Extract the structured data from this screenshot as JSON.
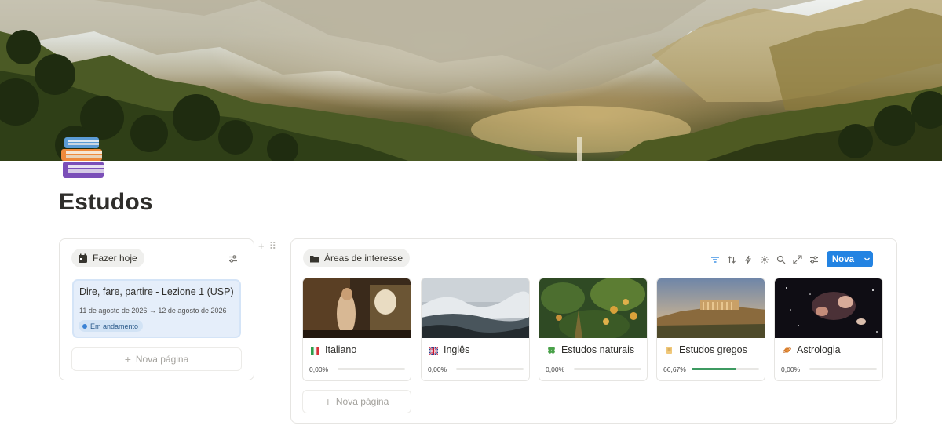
{
  "page": {
    "title": "Estudos",
    "icon": "books-icon"
  },
  "left_db": {
    "tab_label": "Fazer hoje",
    "tab_icon": "calendar-icon",
    "item": {
      "title": "Dire, fare, partire - Lezione 1 (USP)",
      "dates": "11 de agosto de 2026 → 12 de agosto de 2026",
      "status": "Em andamento"
    },
    "new_page_label": "Nova página"
  },
  "right_db": {
    "tab_label": "Áreas de interesse",
    "tab_icon": "folder-icon",
    "toolbar": {
      "icons": [
        "filter-icon",
        "sort-icon",
        "automation-icon",
        "ai-sparkle-icon",
        "search-icon",
        "expand-icon",
        "settings-icon"
      ],
      "new_label": "Nova"
    },
    "cards": [
      {
        "name": "Italiano",
        "icon": "italy-flag-icon",
        "progress_label": "0,00%",
        "progress": 0
      },
      {
        "name": "Inglês",
        "icon": "uk-flag-icon",
        "progress_label": "0,00%",
        "progress": 0
      },
      {
        "name": "Estudos naturais",
        "icon": "clover-icon",
        "progress_label": "0,00%",
        "progress": 0
      },
      {
        "name": "Estudos gregos",
        "icon": "scroll-icon",
        "progress_label": "66,67%",
        "progress": 0.6667
      },
      {
        "name": "Astrologia",
        "icon": "planet-icon",
        "progress_label": "0,00%",
        "progress": 0
      }
    ],
    "new_page_label": "Nova página"
  },
  "colors": {
    "accent": "#2383e2",
    "progress": "#3d9a61",
    "status_bg": "#d2e3f5"
  }
}
